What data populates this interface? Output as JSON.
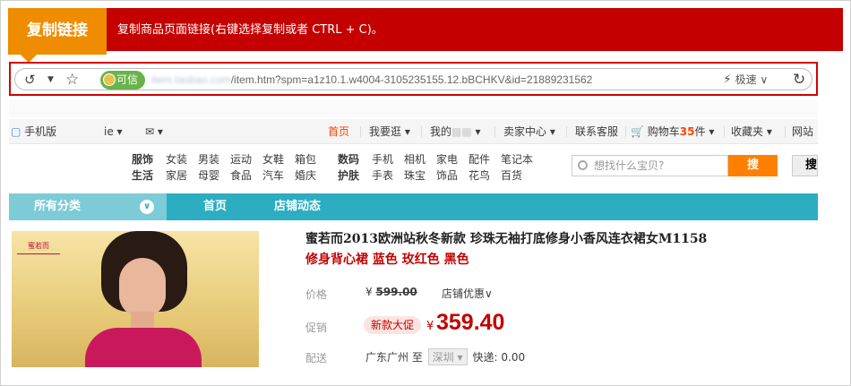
{
  "banner": {
    "tag": "复制链接",
    "text": "复制商品页面链接(右键选择复制或者 CTRL + C)。"
  },
  "browser": {
    "secure_label": "可信",
    "url_blurred": "item.taobao.com",
    "url_visible": "/item.htm?spm=a1z10.1.w4004-3105235155.12.bBCHKV&id=21889231562",
    "mode_label": "极速"
  },
  "site_nav": {
    "mobile": "手机版",
    "mobile_suffix": "ie",
    "home": "首页",
    "shopping": "我要逛",
    "my": "我的",
    "seller": "卖家中心",
    "service": "联系客服",
    "cart_prefix": "购物车",
    "cart_count": "35",
    "cart_suffix": "件",
    "favorites": "收藏夹",
    "sitemap": "网站"
  },
  "categories": {
    "group1": [
      {
        "head": "服饰",
        "items": [
          "女装",
          "男装",
          "运动",
          "女鞋",
          "箱包"
        ]
      },
      {
        "head": "生活",
        "items": [
          "家居",
          "母婴",
          "食品",
          "汽车",
          "婚庆"
        ]
      }
    ],
    "group2": [
      {
        "head": "数码",
        "items": [
          "手机",
          "相机",
          "家电",
          "配件",
          "笔记本"
        ]
      },
      {
        "head": "护肤",
        "items": [
          "手表",
          "珠宝",
          "饰品",
          "花鸟",
          "百货"
        ]
      }
    ]
  },
  "search": {
    "placeholder": "想找什么宝贝?",
    "button": "搜",
    "button2": "搜"
  },
  "shop_nav": {
    "all": "所有分类",
    "tabs": [
      "首页",
      "店铺动态"
    ]
  },
  "product": {
    "logo_text": "蜜若而",
    "title": "蜜若而2013欧洲站秋冬新款 珍珠无袖打底修身小香风连衣裙女M1158",
    "subtitle": "修身背心裙 蓝色 玫红色 黑色",
    "price_label": "价格",
    "old_price_symbol": "¥",
    "old_price": "599.00",
    "shop_discount": "店铺优惠",
    "promo_label": "促销",
    "promo_badge": "新款大促",
    "currency": "¥",
    "price": "359.40",
    "ship_label": "配送",
    "ship_from": "广东广州 至",
    "ship_to": "深圳",
    "ship_fee": "快递: 0.00"
  },
  "colors": {
    "banner": "#c40000",
    "tag": "#f08c00",
    "shop_nav": "#2cadc1",
    "price": "#c40000"
  }
}
